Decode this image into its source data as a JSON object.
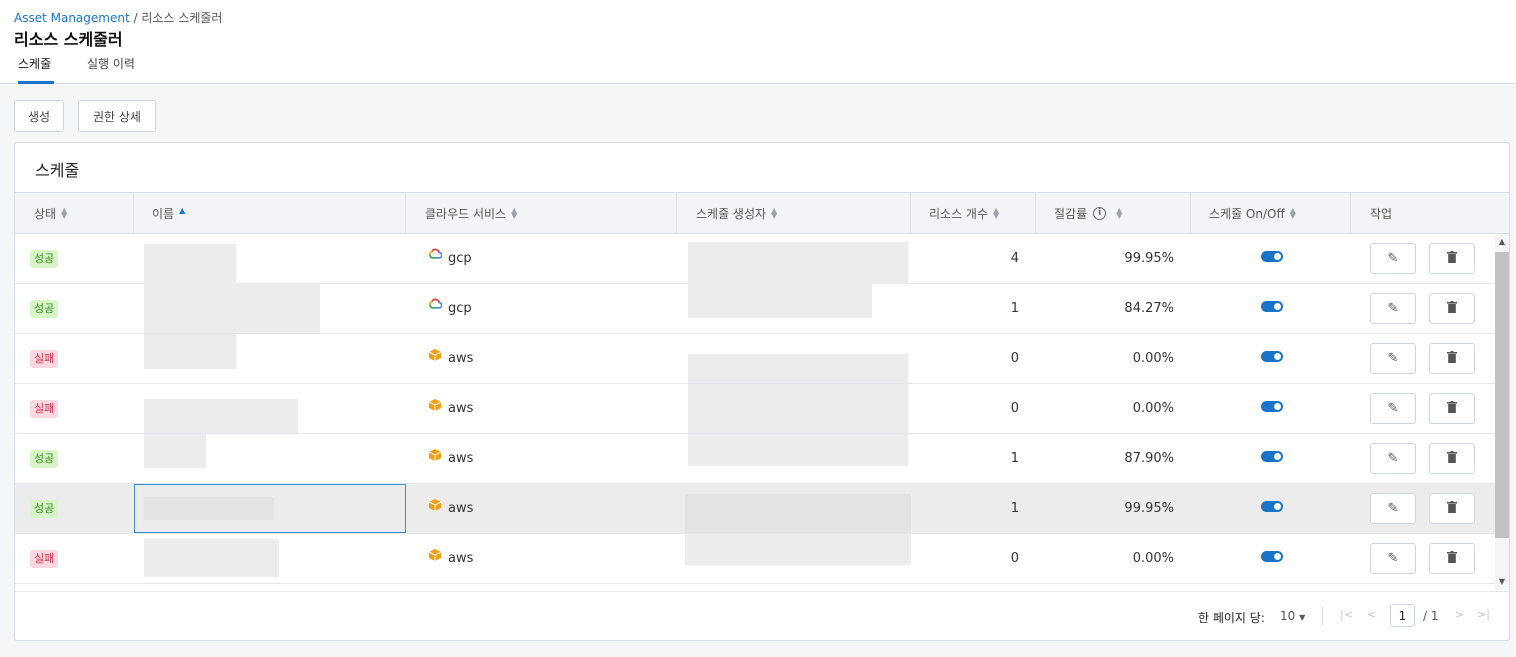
{
  "breadcrumb": {
    "root": "Asset Management",
    "sep": " / ",
    "current": "리소스 스케줄러"
  },
  "page_title": "리소스 스케줄러",
  "tabs": [
    {
      "label": "스케줄",
      "active": true
    },
    {
      "label": "실행 이력",
      "active": false
    }
  ],
  "toolbar": {
    "create_label": "생성",
    "perm_label": "권한 상세"
  },
  "panel": {
    "title": "스케줄"
  },
  "columns": {
    "status": "상태",
    "name": "이름",
    "cloud": "클라우드 서비스",
    "creator": "스케줄 생성자",
    "count": "리소스 개수",
    "savings": "절감률",
    "onoff": "스케줄 On/Off",
    "action": "작업"
  },
  "rows": [
    {
      "status": "성공",
      "status_type": "ok",
      "cloud": "gcp",
      "count": "4",
      "savings": "99.95%",
      "on": true
    },
    {
      "status": "성공",
      "status_type": "ok",
      "cloud": "gcp",
      "count": "1",
      "savings": "84.27%",
      "on": true
    },
    {
      "status": "실패",
      "status_type": "fail",
      "cloud": "aws",
      "count": "0",
      "savings": "0.00%",
      "on": true
    },
    {
      "status": "실패",
      "status_type": "fail",
      "cloud": "aws",
      "count": "0",
      "savings": "0.00%",
      "on": true
    },
    {
      "status": "성공",
      "status_type": "ok",
      "cloud": "aws",
      "count": "1",
      "savings": "87.90%",
      "on": true
    },
    {
      "status": "성공",
      "status_type": "ok",
      "cloud": "aws",
      "count": "1",
      "savings": "99.95%",
      "on": true
    },
    {
      "status": "실패",
      "status_type": "fail",
      "cloud": "aws",
      "count": "0",
      "savings": "0.00%",
      "on": true
    }
  ],
  "pagination": {
    "per_page_label": "한 페이지 당:",
    "per_page": "10",
    "current_page": "1",
    "total": "/ 1"
  },
  "colors": {
    "accent": "#1a73c8",
    "success_bg": "#d8f5c8",
    "fail_bg": "#fcd9e0",
    "aws": "#f29d12"
  }
}
